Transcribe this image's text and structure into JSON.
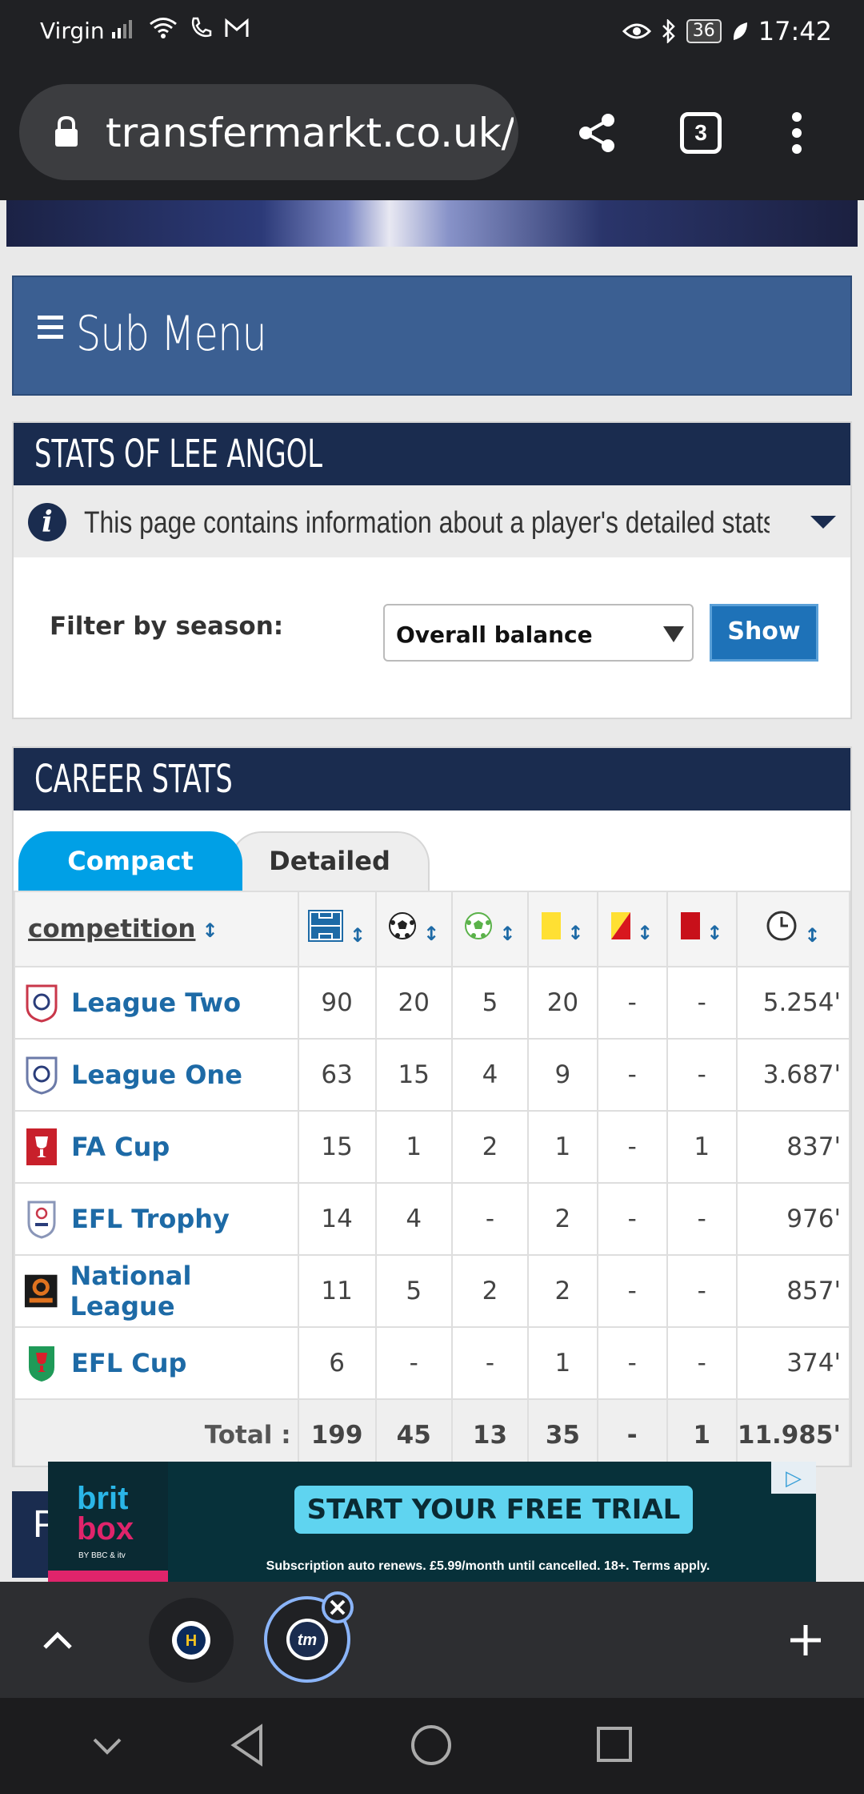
{
  "status_bar": {
    "carrier": "Virgin",
    "battery": "36",
    "time": "17:42"
  },
  "browser": {
    "url": "transfermarkt.co.uk/",
    "tab_count": "3"
  },
  "submenu": {
    "label": "Sub Menu"
  },
  "stats_box": {
    "title": "STATS OF LEE ANGOL",
    "info": "This page contains information about a player's detailed stats. In t...",
    "filter_label": "Filter by season:",
    "season_value": "Overall balance",
    "show_button": "Show"
  },
  "career": {
    "title": "CAREER STATS",
    "tabs": [
      "Compact",
      "Detailed"
    ],
    "header": {
      "competition": "competition",
      "sort": "↕"
    },
    "rows": [
      {
        "name": "League Two",
        "apps": "90",
        "goals": "20",
        "assists": "5",
        "yellow": "20",
        "second_yellow": "-",
        "red": "-",
        "minutes": "5.254'"
      },
      {
        "name": "League One",
        "apps": "63",
        "goals": "15",
        "assists": "4",
        "yellow": "9",
        "second_yellow": "-",
        "red": "-",
        "minutes": "3.687'"
      },
      {
        "name": "FA Cup",
        "apps": "15",
        "goals": "1",
        "assists": "2",
        "yellow": "1",
        "second_yellow": "-",
        "red": "1",
        "minutes": "837'"
      },
      {
        "name": "EFL Trophy",
        "apps": "14",
        "goals": "4",
        "assists": "-",
        "yellow": "2",
        "second_yellow": "-",
        "red": "-",
        "minutes": "976'"
      },
      {
        "name": "National League",
        "apps": "11",
        "goals": "5",
        "assists": "2",
        "yellow": "2",
        "second_yellow": "-",
        "red": "-",
        "minutes": "857'"
      },
      {
        "name": "EFL Cup",
        "apps": "6",
        "goals": "-",
        "assists": "-",
        "yellow": "1",
        "second_yellow": "-",
        "red": "-",
        "minutes": "374'"
      }
    ],
    "total": {
      "label": "Total :",
      "apps": "199",
      "goals": "45",
      "assists": "13",
      "yellow": "35",
      "second_yellow": "-",
      "red": "1",
      "minutes": "11.985'"
    }
  },
  "ad": {
    "brand_line1": "brit",
    "brand_line2": "box",
    "brand_by": "BY BBC & itv",
    "cta": "START YOUR FREE TRIAL",
    "small": "Subscription auto renews. £5.99/month until cancelled. 18+. Terms apply."
  },
  "peek_letter": "P",
  "colors": {
    "header_navy": "#1a2c4f",
    "submenu_blue": "#3b5f92",
    "link_blue": "#1d6aa6",
    "tab_active": "#00a0e6"
  }
}
